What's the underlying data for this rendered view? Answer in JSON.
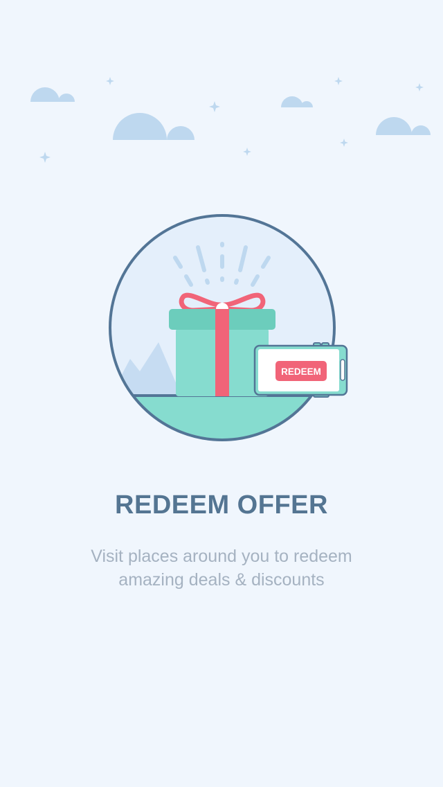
{
  "onboarding": {
    "title": "REDEEM OFFER",
    "description_line1": "Visit places around you to redeem",
    "description_line2": "amazing deals & discounts",
    "phone_button_label": "REDEEM"
  },
  "colors": {
    "background": "#f0f6fd",
    "cloud": "#bed8ef",
    "circle_outline": "#537596",
    "gift_box": "#86dccf",
    "gift_lid": "#6ccdbc",
    "ribbon": "#f16478",
    "title": "#547592",
    "subtitle": "#a5b2c1"
  },
  "icons": {
    "cloud": "cloud-icon",
    "sparkle": "sparkle-icon",
    "gift": "gift-icon",
    "phone": "phone-icon"
  }
}
